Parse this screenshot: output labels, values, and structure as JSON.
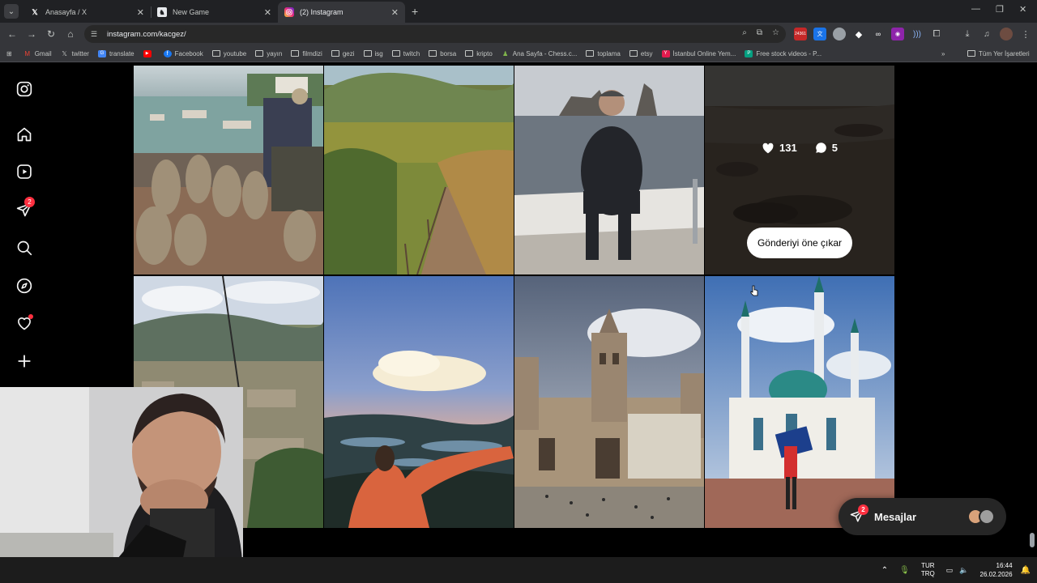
{
  "browser": {
    "tabs": [
      {
        "title": "Anasayfa / X",
        "favicon": "x-logo-icon"
      },
      {
        "title": "New Game",
        "favicon": "chess-icon"
      },
      {
        "title": "(2) Instagram",
        "favicon": "instagram-icon",
        "active": true
      }
    ],
    "url": "instagram.com/kacgez/",
    "extension_badge": "24361",
    "bookmarks": [
      {
        "label": "Gmail",
        "icon": "gmail-icon"
      },
      {
        "label": "twitter",
        "icon": "x-logo-icon"
      },
      {
        "label": "translate",
        "icon": "translate-icon"
      },
      {
        "label": "",
        "icon": "youtube-icon"
      },
      {
        "label": "Facebook",
        "icon": "facebook-icon"
      },
      {
        "label": "youtube",
        "icon": "folder-icon"
      },
      {
        "label": "yayın",
        "icon": "folder-icon"
      },
      {
        "label": "filmdizi",
        "icon": "folder-icon"
      },
      {
        "label": "gezi",
        "icon": "folder-icon"
      },
      {
        "label": "isg",
        "icon": "folder-icon"
      },
      {
        "label": "twitch",
        "icon": "folder-icon"
      },
      {
        "label": "borsa",
        "icon": "folder-icon"
      },
      {
        "label": "kripto",
        "icon": "folder-icon"
      },
      {
        "label": "Ana Sayfa - Chess.c...",
        "icon": "chess-icon"
      },
      {
        "label": "toplama",
        "icon": "folder-icon"
      },
      {
        "label": "etsy",
        "icon": "folder-icon"
      },
      {
        "label": "İstanbul Online Yem...",
        "icon": "yemeksepeti-icon"
      },
      {
        "label": "Free stock videos - P...",
        "icon": "pexels-icon"
      }
    ],
    "all_bookmarks": "Tüm Yer İşaretleri"
  },
  "instagram": {
    "notification_count": "2",
    "hovered_post": {
      "likes": "131",
      "comments": "5",
      "pin_label": "Gönderiyi öne çıkar"
    },
    "messages": {
      "label": "Mesajlar",
      "badge": "2"
    }
  },
  "taskbar": {
    "lang_top": "TUR",
    "lang_bottom": "TRQ",
    "time": "16:44",
    "date": "26.02.2026"
  },
  "colors": {
    "badge": "#ff3040",
    "chrome_dark": "#202124",
    "chrome_mid": "#35363a"
  }
}
